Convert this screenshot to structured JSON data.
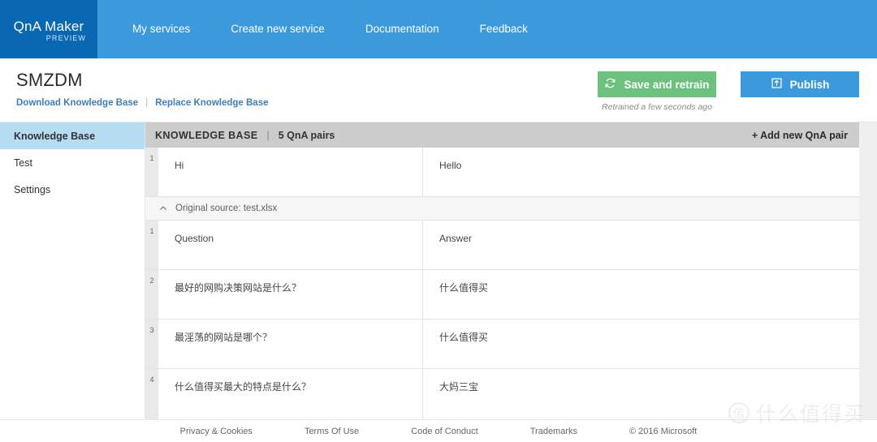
{
  "nav": {
    "brand": {
      "title": "QnA Maker",
      "subtitle": "PREVIEW"
    },
    "links": [
      {
        "label": "My services"
      },
      {
        "label": "Create new service"
      },
      {
        "label": "Documentation"
      },
      {
        "label": "Feedback"
      }
    ]
  },
  "header": {
    "title": "SMZDM",
    "download_link": "Download Knowledge Base",
    "separator": "|",
    "replace_link": "Replace Knowledge Base",
    "save_button": "Save and retrain",
    "save_icon": "refresh-icon",
    "retrain_note": "Retrained a few seconds ago",
    "publish_button": "Publish",
    "publish_icon": "upload-box-icon"
  },
  "sidebar": {
    "items": [
      {
        "label": "Knowledge Base",
        "active": true
      },
      {
        "label": "Test",
        "active": false
      },
      {
        "label": "Settings",
        "active": false
      }
    ]
  },
  "kb_bar": {
    "title": "KNOWLEDGE BASE",
    "separator": "|",
    "count": "5 QnA pairs",
    "add_label": "+ Add new QnA pair"
  },
  "table": {
    "rows_before_source": [
      {
        "num": "1",
        "question": "Hi",
        "answer": "Hello"
      }
    ],
    "source_row": {
      "caret_icon": "chevron-up-icon",
      "label": "Original source: test.xlsx"
    },
    "rows": [
      {
        "num": "1",
        "question": "Question",
        "answer": "Answer"
      },
      {
        "num": "2",
        "question": "最好的网购决策网站是什么？",
        "answer": "什么值得买"
      },
      {
        "num": "3",
        "question": "最淫荡的网站是哪个？",
        "answer": "什么值得买"
      },
      {
        "num": "4",
        "question": "什么值得买最大的特点是什么？",
        "answer": "大妈三宝"
      }
    ]
  },
  "footer": {
    "links": [
      {
        "label": "Privacy & Cookies"
      },
      {
        "label": "Terms Of Use"
      },
      {
        "label": "Code of Conduct"
      },
      {
        "label": "Trademarks"
      }
    ],
    "copyright": "© 2016 Microsoft"
  },
  "watermark": {
    "badge": "值",
    "text": "什么值得买"
  },
  "colors": {
    "nav_blue": "#3c99dc",
    "brand_blue": "#0a67b2",
    "save_green": "#6cc17f",
    "publish_blue": "#3c99dc",
    "link_blue": "#3c7fbc",
    "sidebar_active": "#b5dcf0",
    "kb_bar_gray": "#cccccc"
  }
}
